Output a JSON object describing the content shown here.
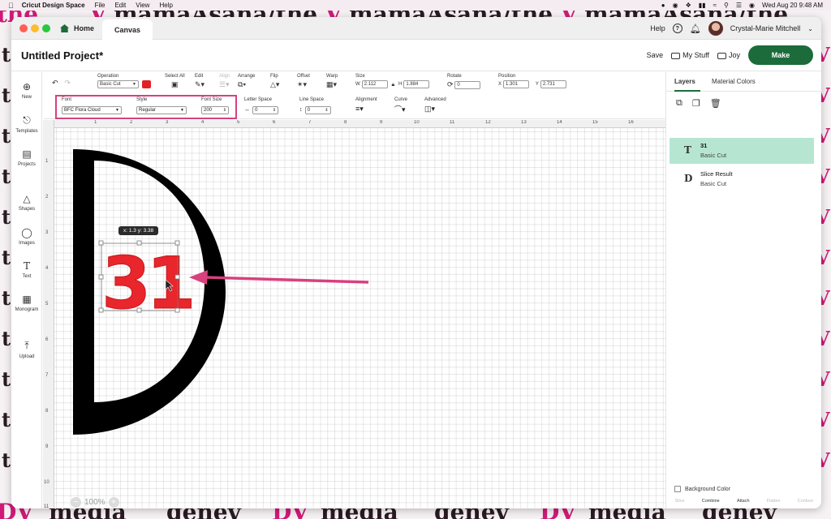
{
  "menubar": {
    "app_name": "Cricut Design Space",
    "menus": [
      "File",
      "Edit",
      "View",
      "Help"
    ],
    "datetime": "Wed Aug 20  9:48 AM"
  },
  "titlebar": {
    "home_tab": "Home",
    "canvas_tab": "Canvas",
    "help": "Help",
    "user_name": "Crystal-Marie Mitchell"
  },
  "project": {
    "title": "Untitled Project*",
    "save": "Save",
    "my_stuff": "My Stuff",
    "joy": "Joy",
    "make": "Make"
  },
  "toolbar": {
    "operation_label": "Operation",
    "operation_value": "Basic Cut",
    "operation_color": "#e22326",
    "select_all": "Select All",
    "edit": "Edit",
    "align": "Align",
    "arrange": "Arrange",
    "flip": "Flip",
    "offset": "Offset",
    "warp": "Warp",
    "size_label": "Size",
    "w_label": "W",
    "w_value": "2.112",
    "h_label": "H",
    "h_value": "1.884",
    "rotate_label": "Rotate",
    "rotate_value": "0",
    "position_label": "Position",
    "x_label": "X",
    "x_value": "1.301",
    "y_label": "Y",
    "y_value": "2.731"
  },
  "text_toolbar": {
    "font_label": "Font",
    "font_value": "BFC Flora Cloud",
    "style_label": "Style",
    "style_value": "Regular",
    "font_size_label": "Font Size",
    "font_size_value": "200",
    "letter_space_label": "Letter Space",
    "letter_space_value": "0",
    "line_space_label": "Line Space",
    "line_space_value": "0",
    "alignment_label": "Alignment",
    "curve_label": "Curve",
    "advanced_label": "Advanced"
  },
  "sidebar": {
    "items": [
      {
        "label": "New",
        "icon": "plus-circle-icon"
      },
      {
        "label": "Templates",
        "icon": "shirt-icon"
      },
      {
        "label": "Projects",
        "icon": "clipboard-icon"
      },
      {
        "label": "Shapes",
        "icon": "shapes-icon"
      },
      {
        "label": "Images",
        "icon": "lightbulb-icon"
      },
      {
        "label": "Text",
        "icon": "text-icon"
      },
      {
        "label": "Monogram",
        "icon": "monogram-icon"
      },
      {
        "label": "Upload",
        "icon": "upload-icon"
      }
    ]
  },
  "canvas": {
    "ruler_top": [
      "1",
      "2",
      "3",
      "4",
      "5",
      "6",
      "7",
      "8",
      "9",
      "10",
      "11",
      "12",
      "13",
      "14",
      "15",
      "16"
    ],
    "ruler_left": [
      "1",
      "2",
      "3",
      "4",
      "5",
      "6",
      "7",
      "8",
      "9",
      "10",
      "11"
    ],
    "text_content": "31",
    "text_color": "#e8262b",
    "d_shape_color": "#000000",
    "arrow_color": "#d8407e",
    "coord_tooltip": "x: 1.3  y: 3.38",
    "zoom": "100%"
  },
  "right_panel": {
    "tabs": [
      "Layers",
      "Material Colors"
    ],
    "layers": [
      {
        "name": "31",
        "operation": "Basic Cut",
        "icon": "T"
      },
      {
        "name": "Slice Result",
        "operation": "Basic Cut",
        "icon": "D"
      }
    ],
    "background_color": "Background Color",
    "bottom_actions": [
      "Slice",
      "Combine",
      "Attach",
      "Flatten",
      "Contour"
    ]
  },
  "desktop": {
    "top_words": [
      "the",
      "V",
      "mamaAsana/the",
      "V",
      "mamaAsana/the",
      "V",
      "mamaAsana/the"
    ],
    "bottom_words": [
      "DV",
      "media",
      "genev",
      "DV",
      "media",
      "genev",
      "DV",
      "media",
      "genev"
    ]
  }
}
